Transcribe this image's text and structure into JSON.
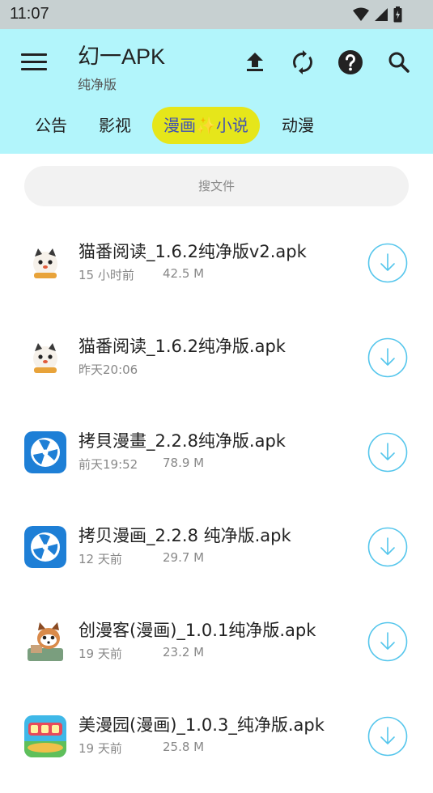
{
  "status_bar": {
    "time": "11:07",
    "icons": [
      "wifi-icon",
      "signal-icon",
      "battery-icon"
    ]
  },
  "header": {
    "title": "幻一APK",
    "subtitle": "纯净版",
    "icons": [
      "menu-icon",
      "upload-icon",
      "refresh-icon",
      "help-icon",
      "search-icon"
    ],
    "background": "#b2f5fb"
  },
  "tabs": [
    {
      "label": "公告",
      "active": false
    },
    {
      "label": "影视",
      "active": false
    },
    {
      "label": "漫画✨小说",
      "active": true
    },
    {
      "label": "动漫",
      "active": false
    }
  ],
  "colors": {
    "active_tab_bg": "#e6e61a",
    "active_tab_text": "#3f51b5",
    "download_accent": "#55c6ec"
  },
  "search": {
    "placeholder": "搜文件"
  },
  "files": [
    {
      "name": "猫番阅读_1.6.2纯净版v2.apk",
      "time": "15 小时前",
      "size": "42.5 M",
      "icon": "cat-app-icon"
    },
    {
      "name": "猫番阅读_1.6.2纯净版.apk",
      "time": "昨天20:06",
      "size": "",
      "icon": "cat-app-icon"
    },
    {
      "name": "拷貝漫畫_2.2.8纯净版.apk",
      "time": "前天19:52",
      "size": "78.9 M",
      "icon": "copymanga-icon"
    },
    {
      "name": "拷贝漫画_2.2.8 纯净版.apk",
      "time": "12 天前",
      "size": "29.7 M",
      "icon": "copymanga-icon"
    },
    {
      "name": "创漫客(漫画)_1.0.1纯净版.apk",
      "time": "19 天前",
      "size": "23.2 M",
      "icon": "raccoon-app-icon"
    },
    {
      "name": "美漫园(漫画)_1.0.3_纯净版.apk",
      "time": "19 天前",
      "size": "25.8 M",
      "icon": "meimanyuan-icon"
    }
  ]
}
